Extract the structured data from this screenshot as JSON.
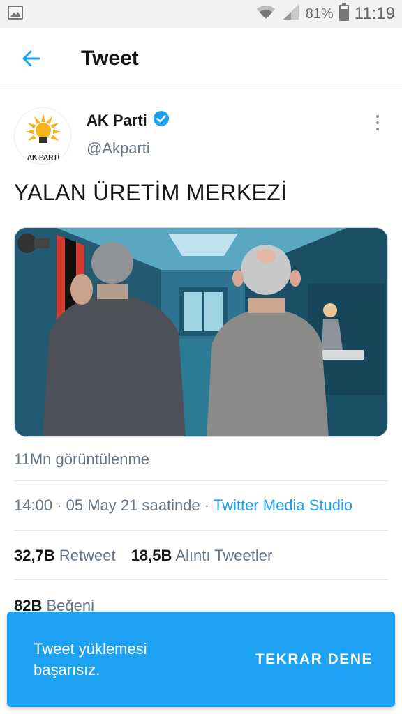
{
  "status_bar": {
    "battery_percent": "81%",
    "time": "11:19",
    "icons": [
      "image-icon",
      "wifi-icon",
      "signal-icon",
      "battery-icon"
    ]
  },
  "app_bar": {
    "title": "Tweet",
    "back_icon": "arrow-left-icon"
  },
  "tweet": {
    "author_name": "AK Parti",
    "author_handle": "@Akparti",
    "verified": true,
    "avatar_text": "AK PARTİ",
    "text": "YALAN ÜRETİM MERKEZİ",
    "views": "11Mn görüntülenme",
    "time": "14:00",
    "date_text": "05 May 21 saatinde",
    "separator": "·",
    "source": "Twitter Media Studio",
    "retweets_count": "32,7B",
    "retweets_label": "Retweet",
    "quotes_count": "18,5B",
    "quotes_label": "Alıntı Tweetler",
    "likes_count": "82B",
    "likes_label": "Beğeni"
  },
  "snackbar": {
    "message": "Tweet yüklemesi başarısız.",
    "action": "TEKRAR DENE"
  },
  "colors": {
    "accent": "#1da1f2",
    "text_primary": "#14171a",
    "text_secondary": "#657786",
    "divider": "#e1e8ed"
  }
}
